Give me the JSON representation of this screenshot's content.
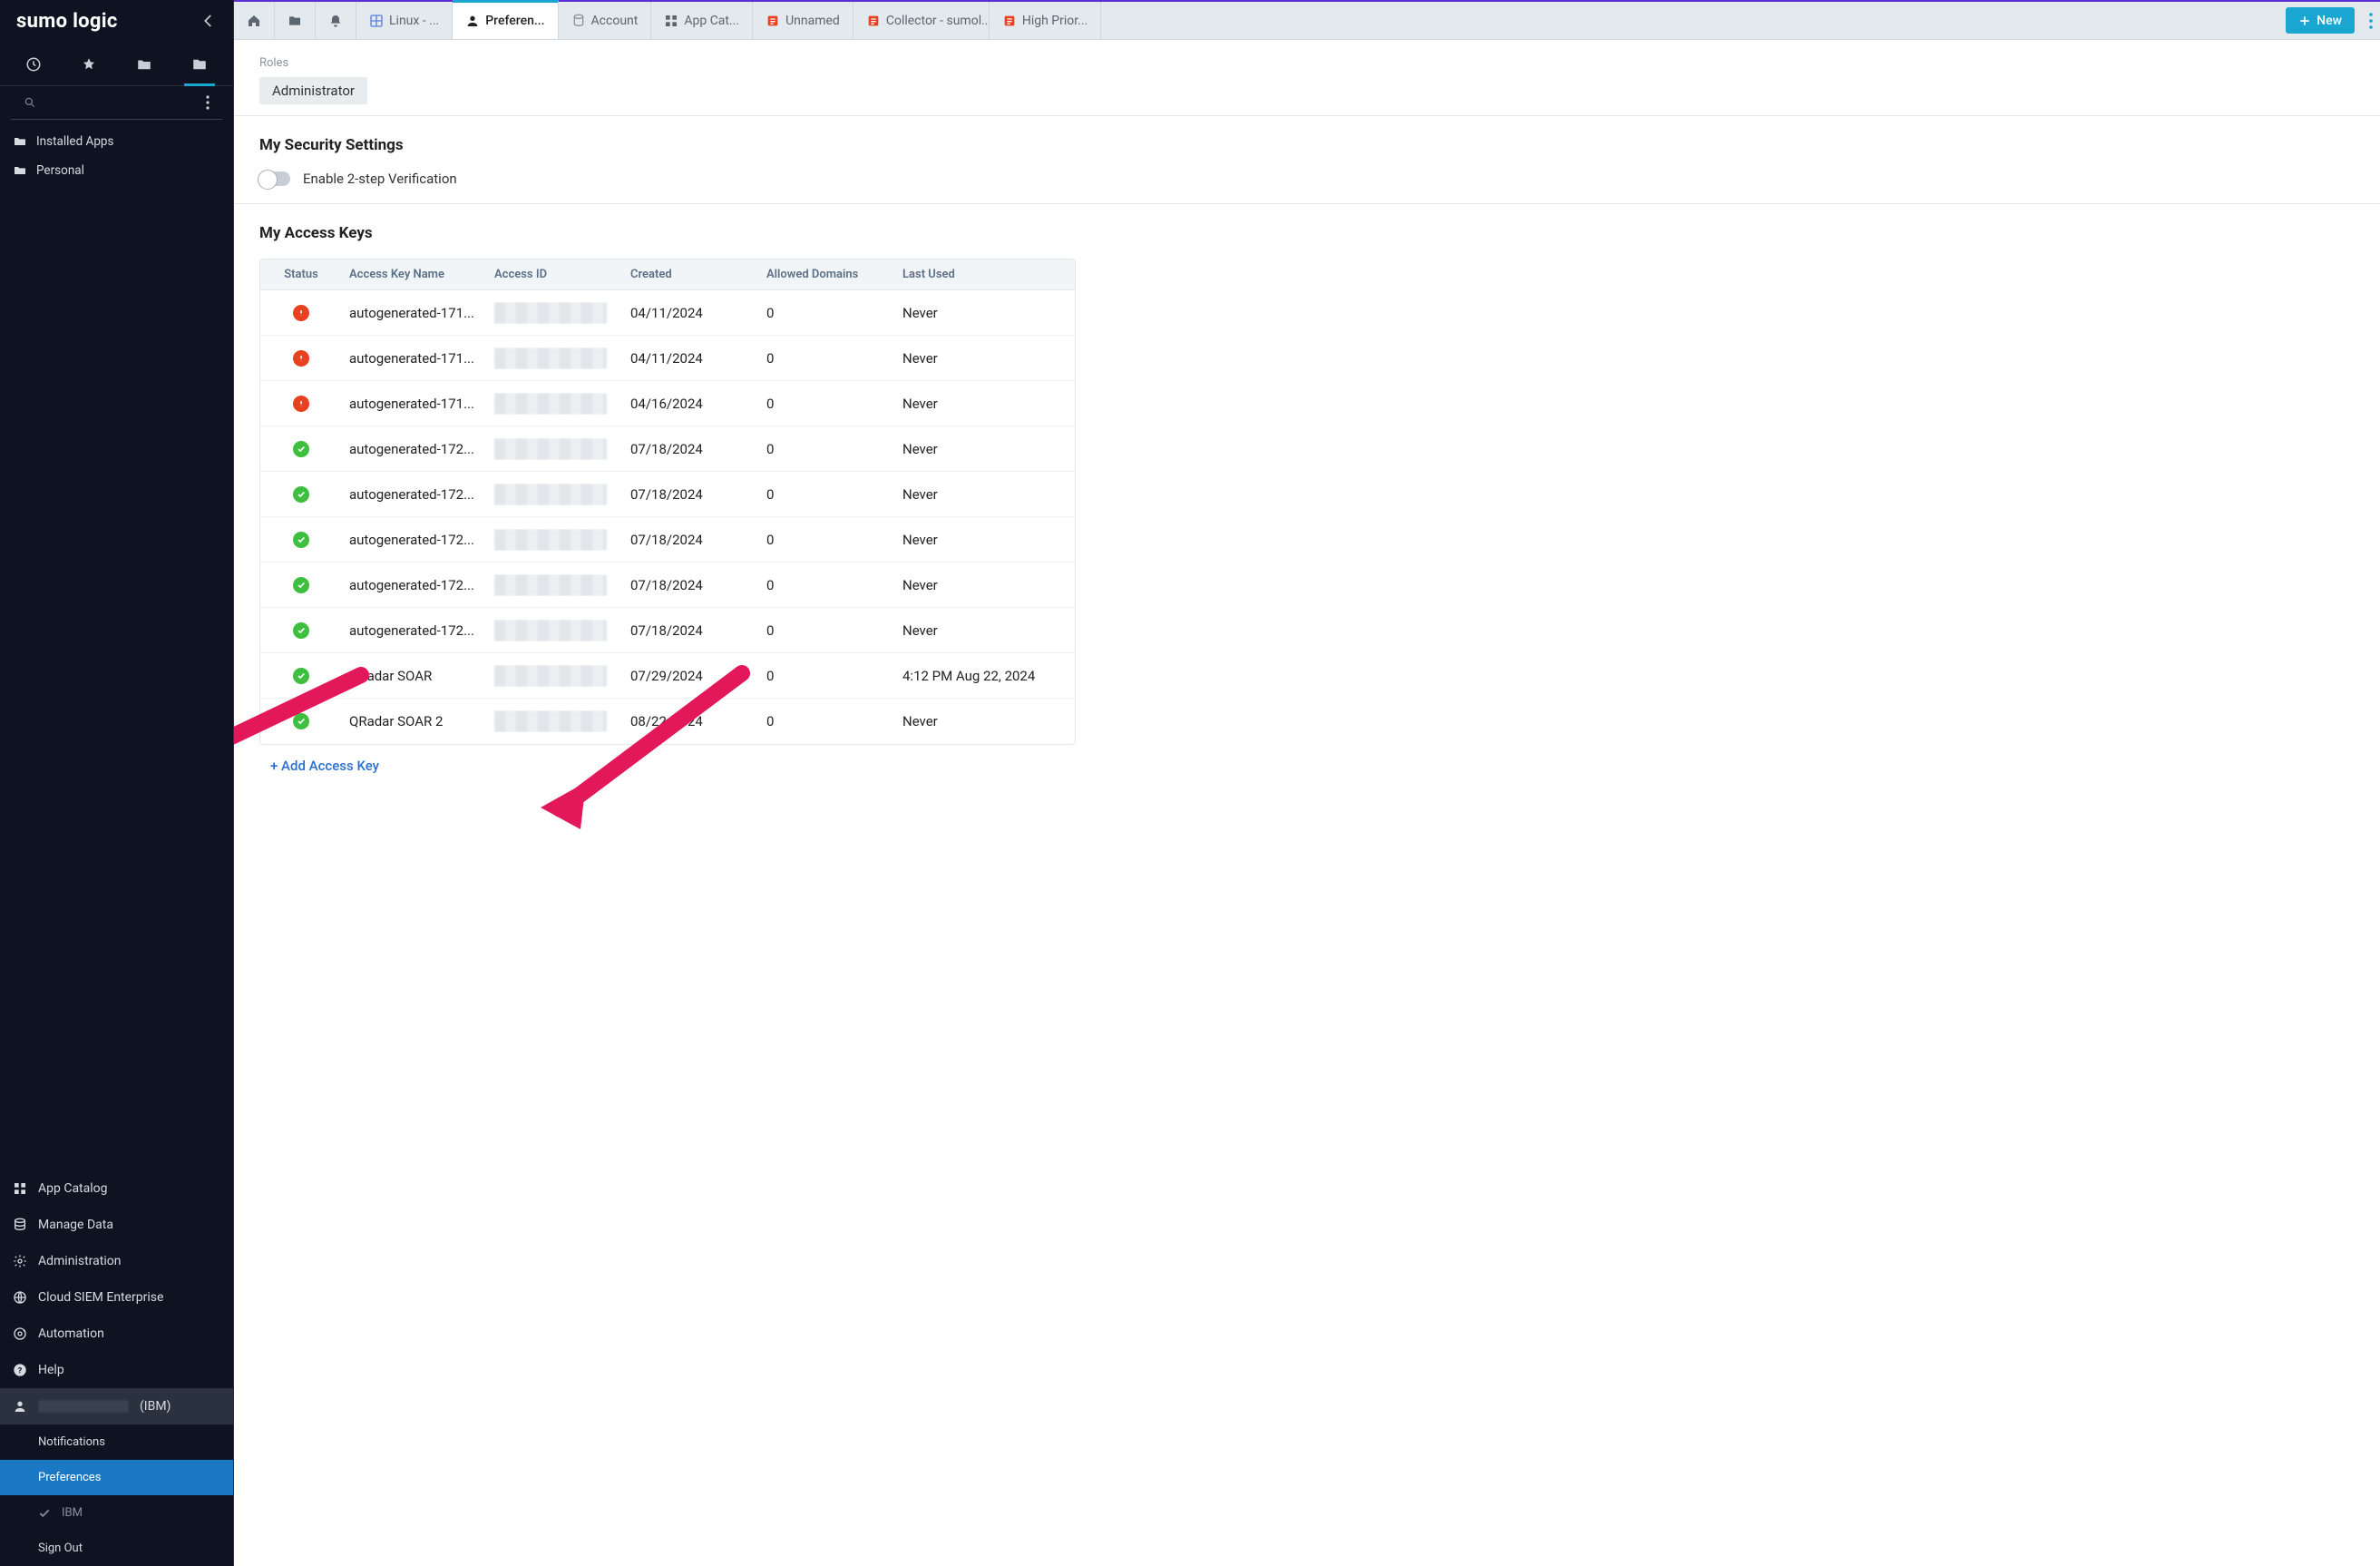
{
  "brand": "sumo logic",
  "sidebar": {
    "search_placeholder": "",
    "tree": [
      {
        "label": "Installed Apps"
      },
      {
        "label": "Personal"
      }
    ],
    "bottom": {
      "app_catalog": "App Catalog",
      "manage_data": "Manage Data",
      "administration": "Administration",
      "cloud_siem": "Cloud SIEM Enterprise",
      "automation": "Automation",
      "help": "Help",
      "user_suffix": "(IBM)",
      "notifications": "Notifications",
      "preferences": "Preferences",
      "org": "IBM",
      "sign_out": "Sign Out"
    }
  },
  "tabs": {
    "linux": "Linux - ...",
    "preferences": "Preferen...",
    "account": "Account",
    "app_cat": "App Cat...",
    "unnamed": "Unnamed",
    "collector": "Collector - sumol...",
    "high_pri": "High Prior...",
    "new": "New"
  },
  "roles": {
    "label": "Roles",
    "chip": "Administrator"
  },
  "security": {
    "heading": "My Security Settings",
    "toggle_label": "Enable 2-step Verification"
  },
  "access_keys": {
    "heading": "My Access Keys",
    "columns": {
      "status": "Status",
      "name": "Access Key Name",
      "id": "Access ID",
      "created": "Created",
      "domains": "Allowed Domains",
      "last_used": "Last Used"
    },
    "rows": [
      {
        "status": "warn",
        "name": "autogenerated-171...",
        "created": "04/11/2024",
        "domains": "0",
        "last_used": "Never"
      },
      {
        "status": "warn",
        "name": "autogenerated-171...",
        "created": "04/11/2024",
        "domains": "0",
        "last_used": "Never"
      },
      {
        "status": "warn",
        "name": "autogenerated-171...",
        "created": "04/16/2024",
        "domains": "0",
        "last_used": "Never"
      },
      {
        "status": "ok",
        "name": "autogenerated-172...",
        "created": "07/18/2024",
        "domains": "0",
        "last_used": "Never"
      },
      {
        "status": "ok",
        "name": "autogenerated-172...",
        "created": "07/18/2024",
        "domains": "0",
        "last_used": "Never"
      },
      {
        "status": "ok",
        "name": "autogenerated-172...",
        "created": "07/18/2024",
        "domains": "0",
        "last_used": "Never"
      },
      {
        "status": "ok",
        "name": "autogenerated-172...",
        "created": "07/18/2024",
        "domains": "0",
        "last_used": "Never"
      },
      {
        "status": "ok",
        "name": "autogenerated-172...",
        "created": "07/18/2024",
        "domains": "0",
        "last_used": "Never"
      },
      {
        "status": "ok",
        "name": "QRadar SOAR",
        "created": "07/29/2024",
        "domains": "0",
        "last_used": "4:12 PM Aug 22, 2024"
      },
      {
        "status": "ok",
        "name": "QRadar SOAR 2",
        "created": "08/22/2024",
        "domains": "0",
        "last_used": "Never"
      }
    ],
    "add_link": "+ Add Access Key"
  }
}
